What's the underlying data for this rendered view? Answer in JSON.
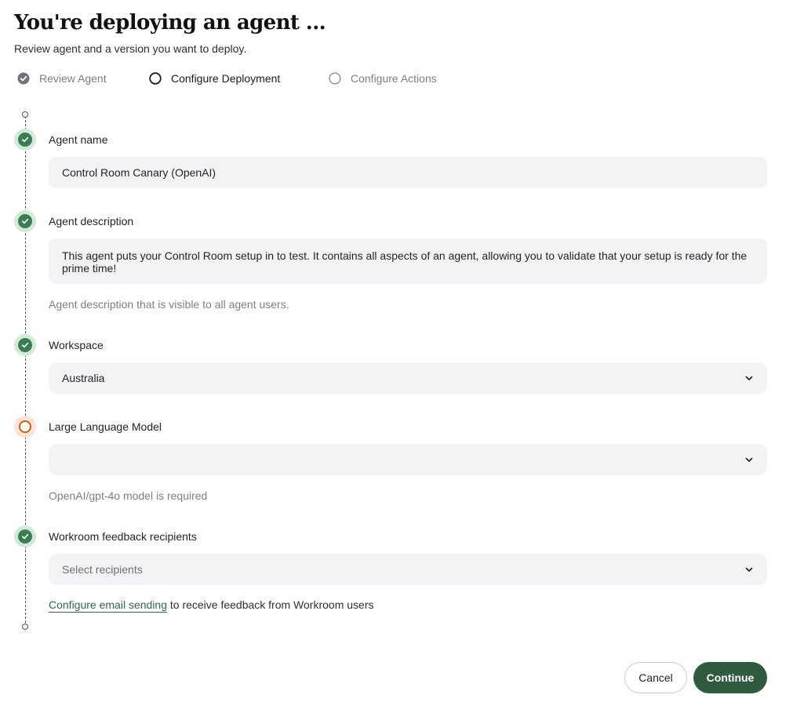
{
  "header": {
    "title": "You're deploying an agent ...",
    "subtitle": "Review agent and a version you want to deploy."
  },
  "steps": [
    {
      "label": "Review Agent",
      "state": "done"
    },
    {
      "label": "Configure Deployment",
      "state": "active"
    },
    {
      "label": "Configure Actions",
      "state": "todo"
    }
  ],
  "form": {
    "agent_name": {
      "label": "Agent name",
      "value": "Control Room Canary (OpenAI)",
      "status": "complete"
    },
    "agent_description": {
      "label": "Agent description",
      "value": "This agent puts your Control Room setup in to test. It contains all aspects of an agent, allowing you to validate that your setup is ready for the prime time!",
      "hint": "Agent description that is visible to all agent users.",
      "status": "complete"
    },
    "workspace": {
      "label": "Workspace",
      "value": "Australia",
      "status": "complete"
    },
    "llm": {
      "label": "Large Language Model",
      "value": "",
      "hint": "OpenAI/gpt-4o model is required",
      "status": "warning"
    },
    "recipients": {
      "label": "Workroom feedback recipients",
      "placeholder": "Select recipients",
      "status": "complete",
      "note_link": "Configure email sending",
      "note_text": " to receive feedback from Workroom users"
    }
  },
  "actions": {
    "cancel_label": "Cancel",
    "continue_label": "Continue"
  },
  "colors": {
    "accent": "#2f5a3e",
    "success": "#3a7d50",
    "warning": "#c8611d",
    "field_bg": "#f2f3f5"
  }
}
